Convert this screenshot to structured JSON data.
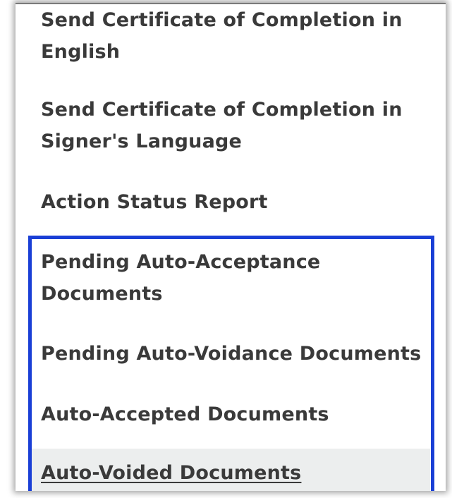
{
  "menu": {
    "items": [
      {
        "label": "Send Certificate of Completion in English"
      },
      {
        "label": "Send Certificate of Completion in Signer's Language"
      },
      {
        "label": "Action Status Report"
      },
      {
        "label": "Pending Auto-Acceptance Documents"
      },
      {
        "label": "Pending Auto-Voidance Documents"
      },
      {
        "label": "Auto-Accepted Documents"
      },
      {
        "label": "Auto-Voided Documents"
      }
    ]
  },
  "colors": {
    "highlight_border": "#1a3fd6",
    "text": "#3a3a3a",
    "hover_background": "#eceeee"
  }
}
